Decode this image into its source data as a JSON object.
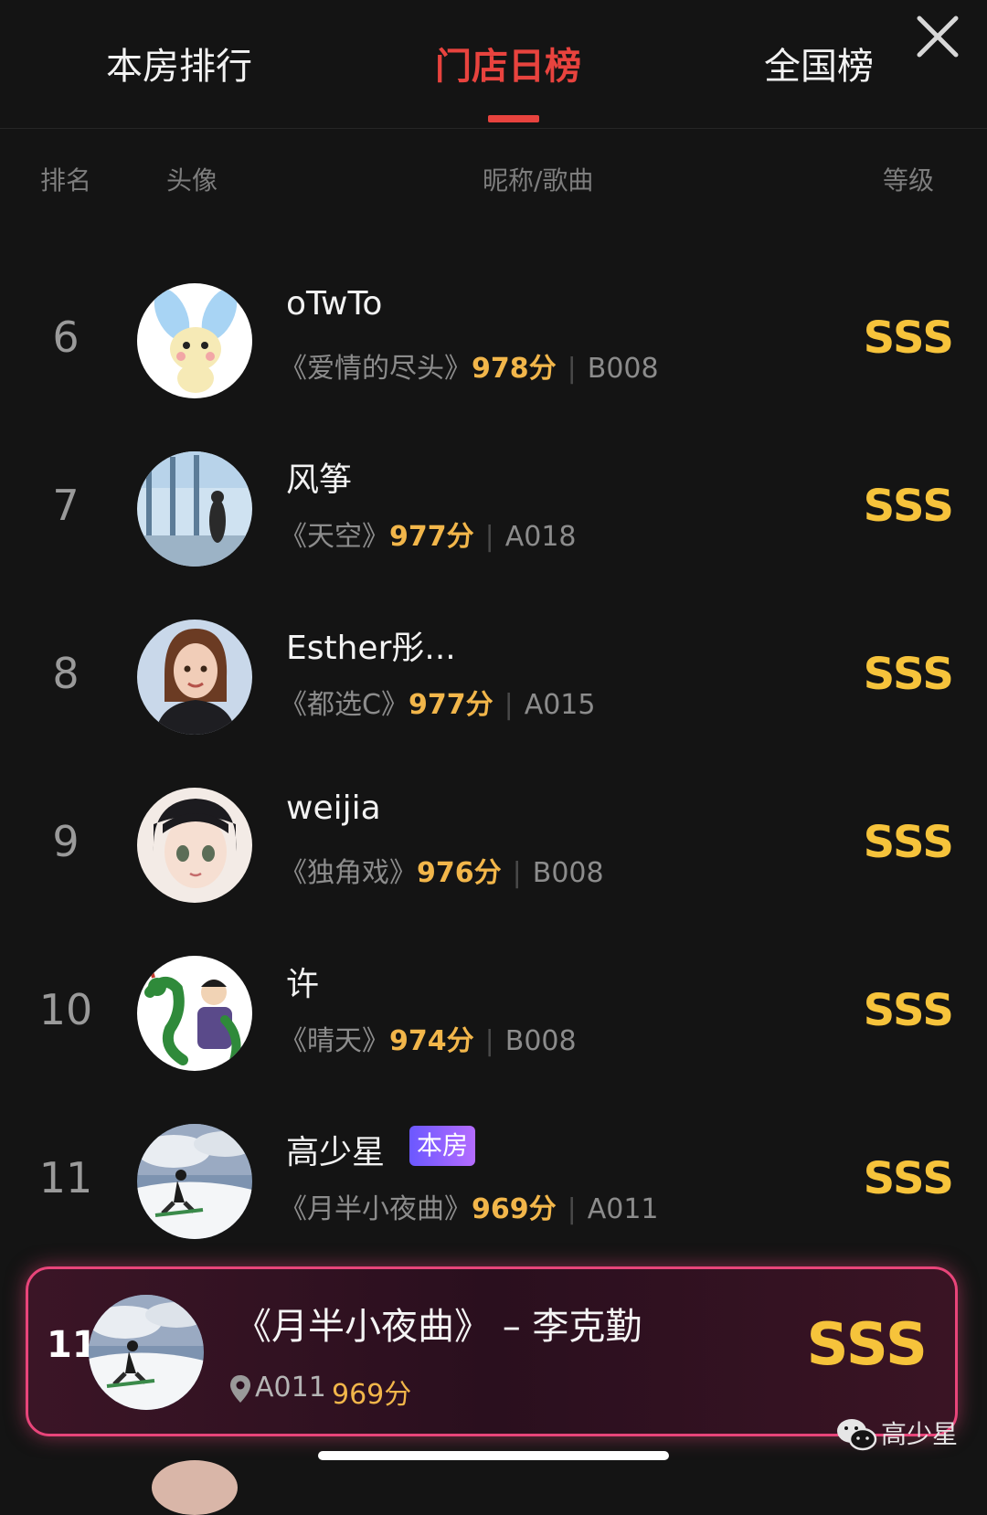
{
  "tabs": {
    "room": "本房排行",
    "store_daily": "门店日榜",
    "national": "全国榜"
  },
  "columns": {
    "rank": "排名",
    "avatar": "头像",
    "nickname_song": "昵称/歌曲",
    "grade": "等级"
  },
  "rows": [
    {
      "rank": "6",
      "nick": "oTwTo",
      "song": "《爱情的尽头》",
      "score": "978分",
      "sep": "|",
      "room": "B008",
      "grade": "SSS"
    },
    {
      "rank": "7",
      "nick": "风筝",
      "song": "《天空》",
      "score": "977分",
      "sep": "|",
      "room": "A018",
      "grade": "SSS"
    },
    {
      "rank": "8",
      "nick": "Esther彤...",
      "song": "《都选C》",
      "score": "977分",
      "sep": "|",
      "room": "A015",
      "grade": "SSS"
    },
    {
      "rank": "9",
      "nick": "weijia",
      "song": "《独角戏》",
      "score": "976分",
      "sep": "|",
      "room": "B008",
      "grade": "SSS"
    },
    {
      "rank": "10",
      "nick": "许",
      "song": "《晴天》",
      "score": "974分",
      "sep": "|",
      "room": "B008",
      "grade": "SSS"
    },
    {
      "rank": "11",
      "nick": "高少星",
      "badge": "本房",
      "song": "《月半小夜曲》",
      "score": "969分",
      "sep": "|",
      "room": "A011",
      "grade": "SSS"
    }
  ],
  "current": {
    "rank": "11",
    "title": "《月半小夜曲》 – 李克勤",
    "room": "A011",
    "score": "969分",
    "grade": "SSS"
  },
  "watermark": {
    "name": "高少星"
  },
  "colors": {
    "accent_red": "#e8433e",
    "score_orange": "#f2b64a",
    "grade_gold": "#f6c33b",
    "highlight_border": "#e8457a",
    "badge_purple": "#8a60ff"
  },
  "icons": {
    "close": "close-icon",
    "location": "location-pin-icon",
    "wechat": "wechat-icon"
  }
}
